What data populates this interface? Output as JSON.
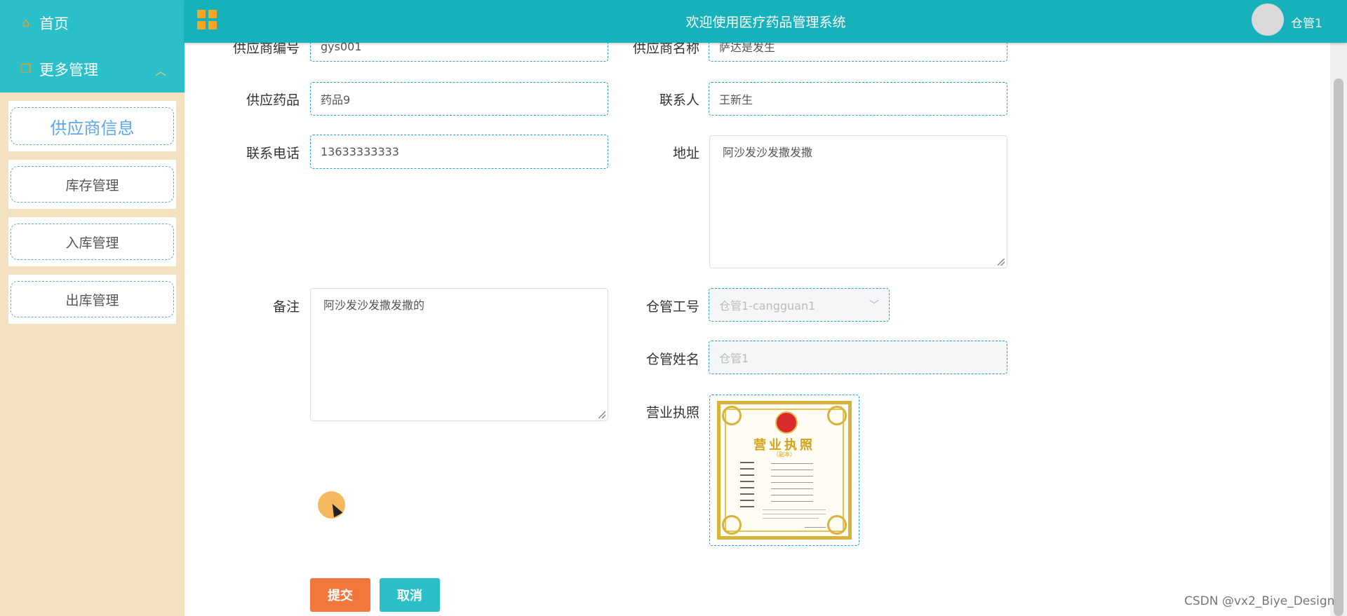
{
  "sidebar": {
    "home_label": "首页",
    "more_label": "更多管理",
    "items": [
      {
        "label": "供应商信息"
      },
      {
        "label": "库存管理"
      },
      {
        "label": "入库管理"
      },
      {
        "label": "出库管理"
      }
    ]
  },
  "header": {
    "title": "欢迎使用医疗药品管理系统",
    "user": "仓管1"
  },
  "form": {
    "supplier_no": {
      "label": "供应商编号",
      "value": "gys001"
    },
    "supplier_name": {
      "label": "供应商名称",
      "value": "萨达是发生"
    },
    "drug": {
      "label": "供应药品",
      "value": "药品9"
    },
    "contact": {
      "label": "联系人",
      "value": "王新生"
    },
    "phone": {
      "label": "联系电话",
      "value": "13633333333"
    },
    "address": {
      "label": "地址",
      "value": "阿沙发沙发撒发撒"
    },
    "remark": {
      "label": "备注",
      "value": "阿沙发沙发撒发撒的"
    },
    "warehouse_id": {
      "label": "仓管工号",
      "value": "仓管1-cangguan1"
    },
    "warehouse_name": {
      "label": "仓管姓名",
      "value": "仓管1"
    },
    "license": {
      "label": "营业执照",
      "doc_title": "营业执照",
      "doc_sub": "（副本）"
    }
  },
  "buttons": {
    "submit": "提交",
    "cancel": "取消"
  },
  "watermark": "CSDN @vx2_Biye_Design",
  "colors": {
    "header": "#17b1bc",
    "sidebar": "#f3e1c0",
    "submit": "#f2773d",
    "cancel": "#2bbfca"
  }
}
